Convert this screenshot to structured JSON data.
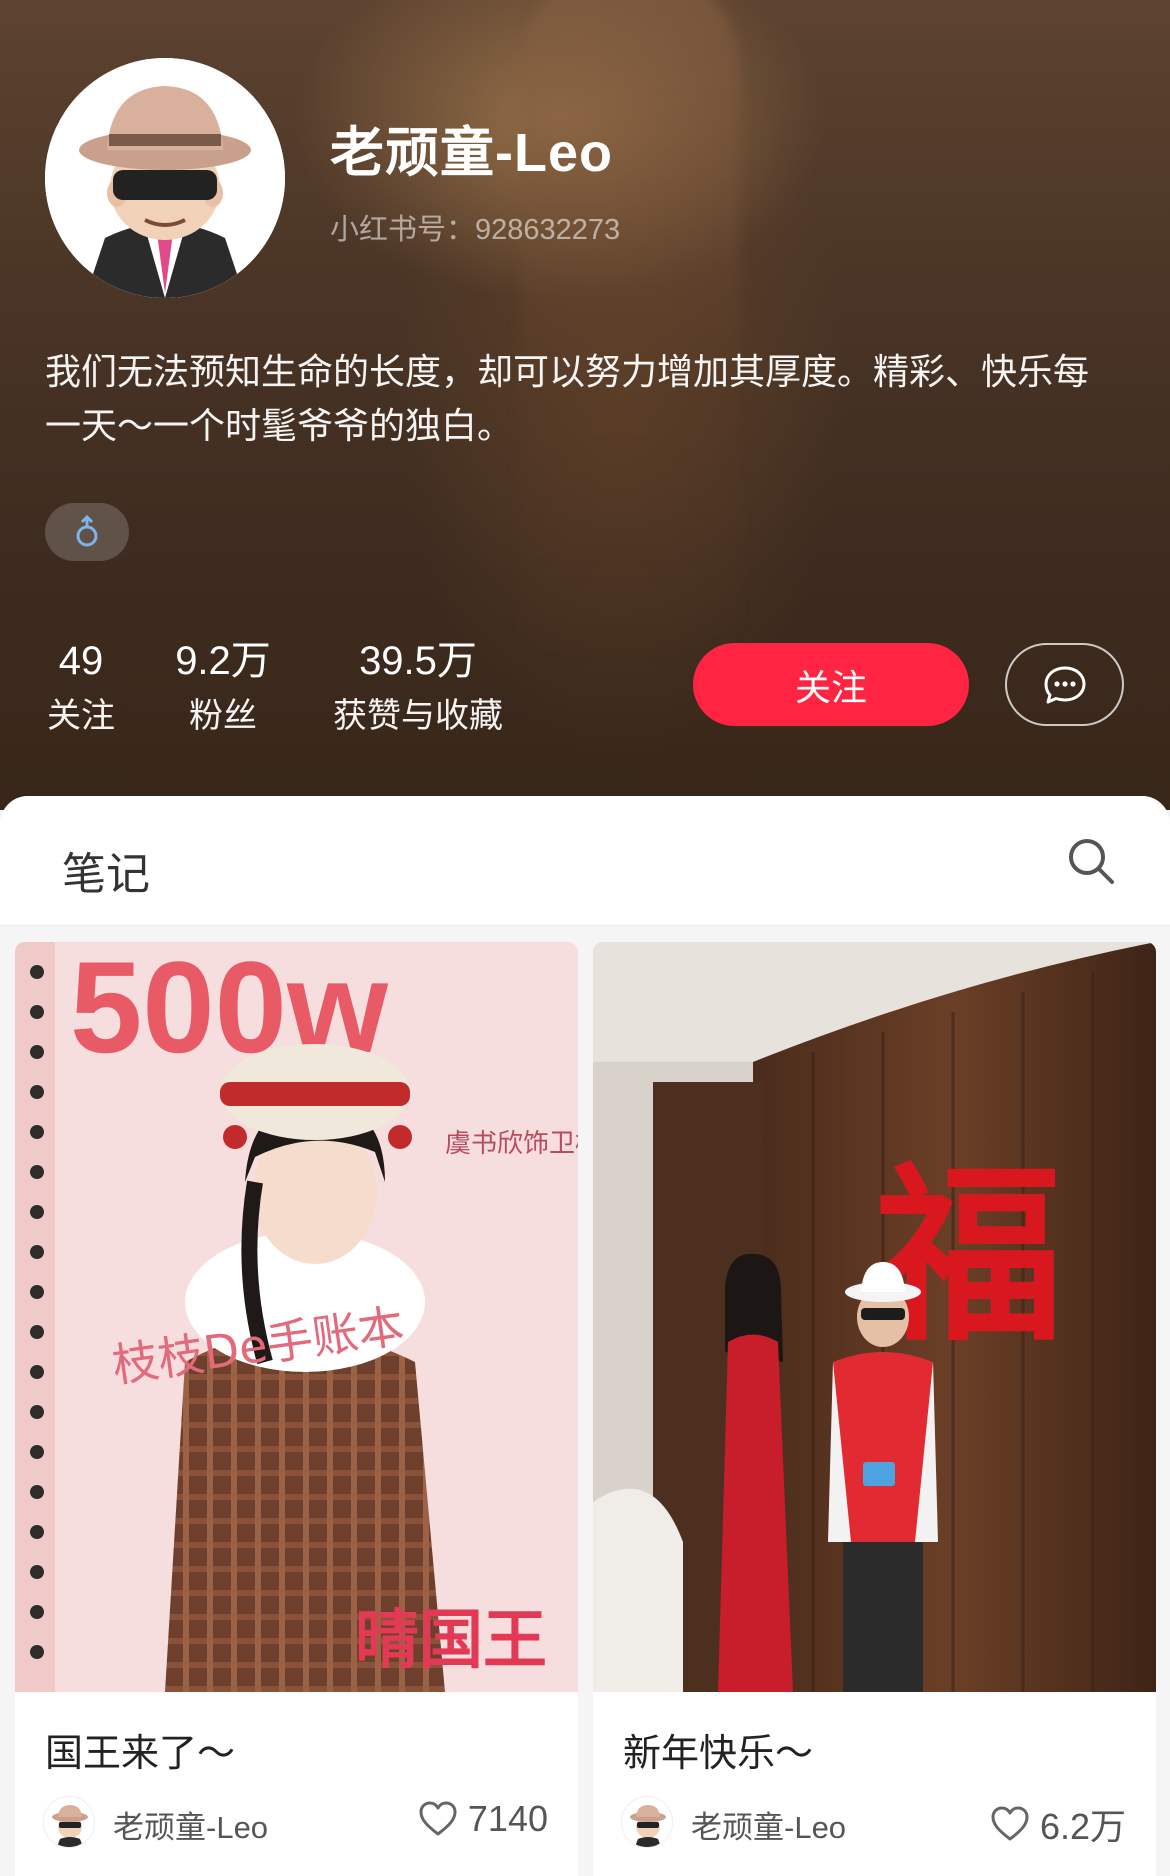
{
  "profile": {
    "username": "老顽童-Leo",
    "red_id": "小红书号：928632273",
    "bio": "我们无法预知生命的长度，却可以努力增加其厚度。精彩、快乐每一天～一个时髦爷爷的独白。",
    "gender_icon": "male-icon"
  },
  "stats": {
    "following": {
      "value": "49",
      "label": "关注"
    },
    "fans": {
      "value": "9.2万",
      "label": "粉丝"
    },
    "likes": {
      "value": "39.5万",
      "label": "获赞与收藏"
    }
  },
  "actions": {
    "follow_label": "关注",
    "message_icon": "chat-bubble-icon"
  },
  "tabs": {
    "notes_label": "笔记",
    "search_icon": "search-icon"
  },
  "notes": [
    {
      "title": "国王来了～",
      "author": "老顽童-Leo",
      "likes": "7140",
      "image_text": [
        "500w",
        "枝枝De手账本",
        "虞书欣饰卫枝",
        "晴国王"
      ]
    },
    {
      "title": "新年快乐～",
      "author": "老顽童-Leo",
      "likes": "6.2万",
      "image_text": [
        "福"
      ]
    }
  ],
  "colors": {
    "brand_red": "#ff2442",
    "header_bg": "#4a3526",
    "panel_bg": "#f5f5f5"
  }
}
